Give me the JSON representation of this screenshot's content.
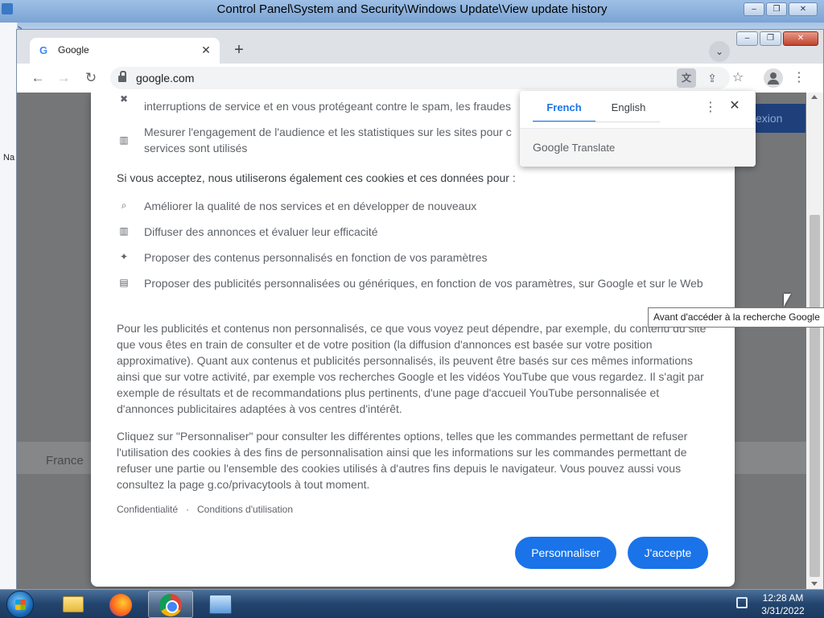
{
  "background_window": {
    "title": "Control Panel\\System and Security\\Windows Update\\View update history",
    "left_label": "Na"
  },
  "browser": {
    "tab": {
      "title": "Google",
      "favicon": "G"
    },
    "url": "google.com"
  },
  "page": {
    "country_label": "France",
    "right_button": "exion"
  },
  "consent": {
    "top_items": [
      {
        "icon": "shield-x-icon",
        "text": "interruptions de service et en vous protégeant contre le spam, les fraudes"
      },
      {
        "icon": "bar-chart-icon",
        "text": "Mesurer l'engagement de l'audience et les statistiques sur les sites pour c services sont utilisés"
      }
    ],
    "heading": "Si vous acceptez, nous utiliserons également ces cookies et ces données pour :",
    "items": [
      {
        "icon": "search-icon",
        "text": "Améliorer la qualité de nos services et en développer de nouveaux"
      },
      {
        "icon": "bar-chart-icon",
        "text": "Diffuser des annonces et évaluer leur efficacité"
      },
      {
        "icon": "sparkle-icon",
        "text": "Proposer des contenus personnalisés en fonction de vos paramètres"
      },
      {
        "icon": "ad-icon",
        "text": "Proposer des publicités personnalisées ou génériques, en fonction de vos paramètres, sur Google et sur le Web"
      }
    ],
    "paragraph1": "Pour les publicités et contenus non personnalisés, ce que vous voyez peut dépendre, par exemple, du contenu du site que vous êtes en train de consulter et de votre position (la diffusion d'annonces est basée sur votre position approximative). Quant aux contenus et publicités personnalisés, ils peuvent être basés sur ces mêmes informations ainsi que sur votre activité, par exemple vos recherches Google et les vidéos YouTube que vous regardez. Il s'agit par exemple de résultats et de recommandations plus pertinents, d'une page d'accueil YouTube personnalisée et d'annonces publicitaires adaptées à vos centres d'intérêt.",
    "paragraph2": "Cliquez sur \"Personnaliser\" pour consulter les différentes options, telles que les commandes permettant de refuser l'utilisation des cookies à des fins de personnalisation ainsi que les informations sur les commandes permettant de refuser une partie ou l'ensemble des cookies utilisés à d'autres fins depuis le navigateur. Vous pouvez aussi vous consultez la page g.co/privacytools à tout moment.",
    "links": {
      "privacy": "Confidentialité",
      "separator": "·",
      "terms": "Conditions d'utilisation"
    },
    "buttons": {
      "customize": "Personnaliser",
      "accept": "J'accepte"
    }
  },
  "translate_popup": {
    "languages": [
      "French",
      "English"
    ],
    "active_language": "French",
    "brand_prefix": "Google",
    "brand_suffix": "Translate"
  },
  "tooltip": "Avant d'accéder à la recherche Google",
  "taskbar": {
    "apps": [
      "windows-explorer",
      "firefox",
      "chrome",
      "control-panel"
    ],
    "active_app": "chrome",
    "time": "12:28 AM",
    "date": "3/31/2022"
  },
  "colors": {
    "accent": "#1a73e8",
    "dialog_text": "#5f6368",
    "overlay": "#747678"
  }
}
